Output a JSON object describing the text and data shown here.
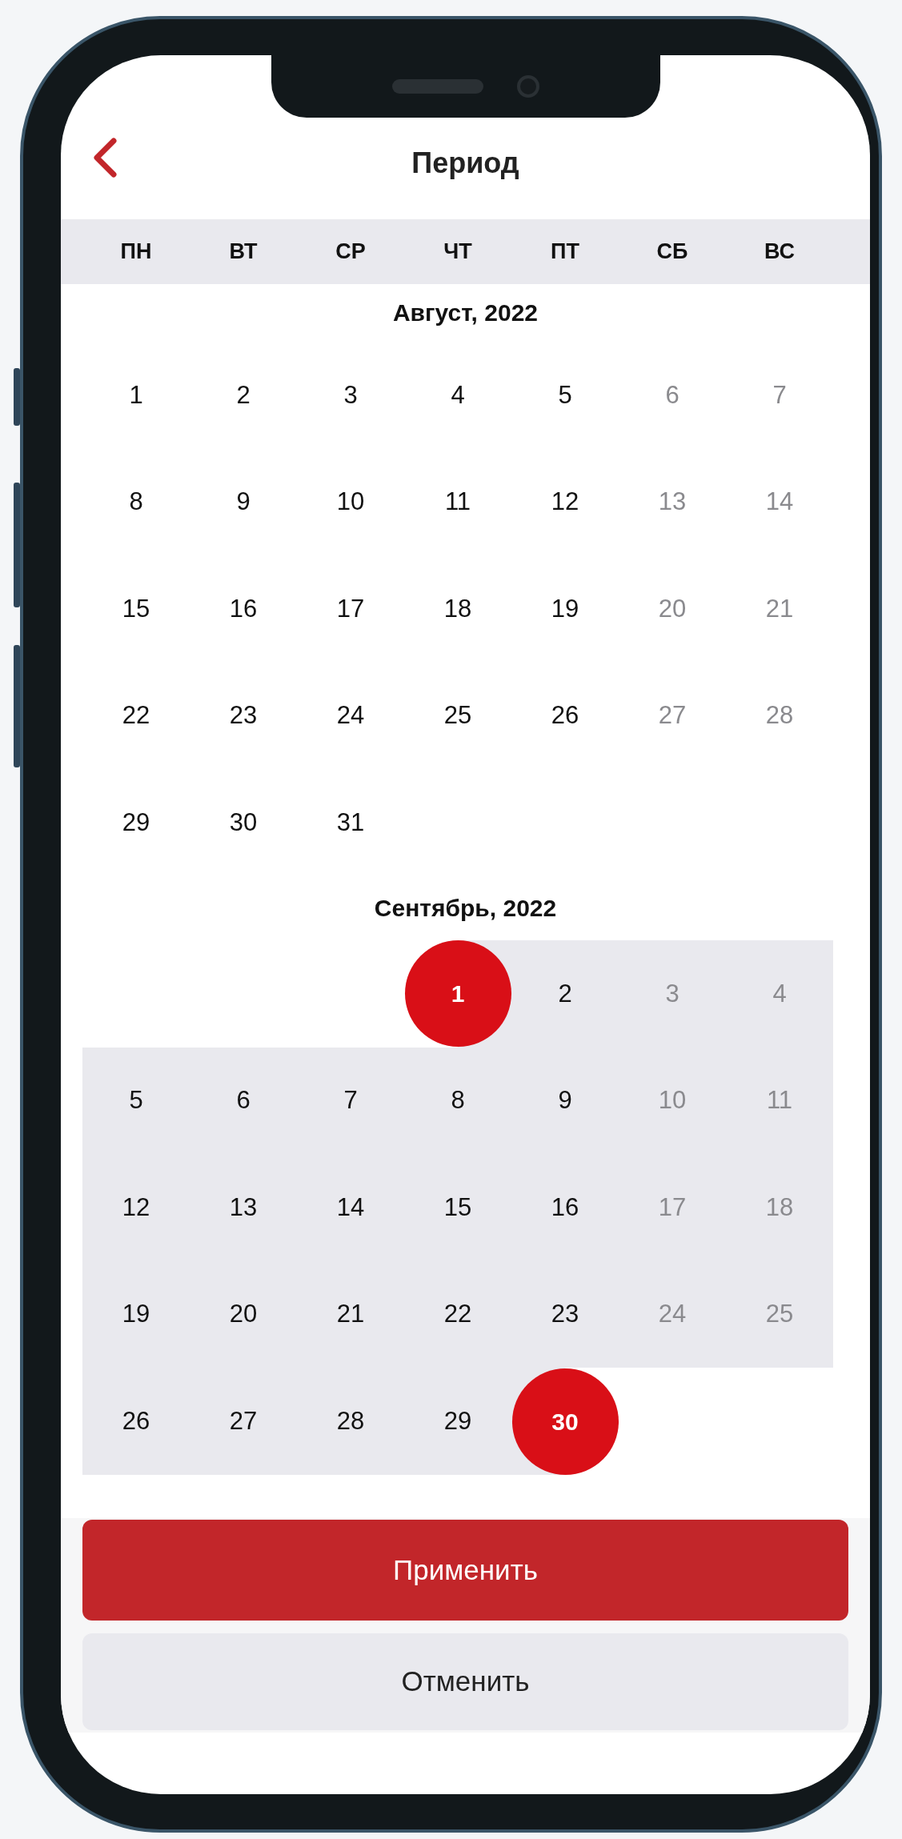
{
  "header": {
    "title": "Период"
  },
  "weekdays": [
    "ПН",
    "ВТ",
    "СР",
    "ЧТ",
    "ПТ",
    "СБ",
    "ВС"
  ],
  "months": [
    {
      "title": "Август, 2022",
      "weeks": [
        [
          {
            "kind": "day",
            "day": "1",
            "weekend": false,
            "in_range": false,
            "selected": false
          },
          {
            "kind": "day",
            "day": "2",
            "weekend": false,
            "in_range": false,
            "selected": false
          },
          {
            "kind": "day",
            "day": "3",
            "weekend": false,
            "in_range": false,
            "selected": false
          },
          {
            "kind": "day",
            "day": "4",
            "weekend": false,
            "in_range": false,
            "selected": false
          },
          {
            "kind": "day",
            "day": "5",
            "weekend": false,
            "in_range": false,
            "selected": false
          },
          {
            "kind": "day",
            "day": "6",
            "weekend": true,
            "in_range": false,
            "selected": false
          },
          {
            "kind": "day",
            "day": "7",
            "weekend": true,
            "in_range": false,
            "selected": false
          }
        ],
        [
          {
            "kind": "day",
            "day": "8",
            "weekend": false,
            "in_range": false,
            "selected": false
          },
          {
            "kind": "day",
            "day": "9",
            "weekend": false,
            "in_range": false,
            "selected": false
          },
          {
            "kind": "day",
            "day": "10",
            "weekend": false,
            "in_range": false,
            "selected": false
          },
          {
            "kind": "day",
            "day": "11",
            "weekend": false,
            "in_range": false,
            "selected": false
          },
          {
            "kind": "day",
            "day": "12",
            "weekend": false,
            "in_range": false,
            "selected": false
          },
          {
            "kind": "day",
            "day": "13",
            "weekend": true,
            "in_range": false,
            "selected": false
          },
          {
            "kind": "day",
            "day": "14",
            "weekend": true,
            "in_range": false,
            "selected": false
          }
        ],
        [
          {
            "kind": "day",
            "day": "15",
            "weekend": false,
            "in_range": false,
            "selected": false
          },
          {
            "kind": "day",
            "day": "16",
            "weekend": false,
            "in_range": false,
            "selected": false
          },
          {
            "kind": "day",
            "day": "17",
            "weekend": false,
            "in_range": false,
            "selected": false
          },
          {
            "kind": "day",
            "day": "18",
            "weekend": false,
            "in_range": false,
            "selected": false
          },
          {
            "kind": "day",
            "day": "19",
            "weekend": false,
            "in_range": false,
            "selected": false
          },
          {
            "kind": "day",
            "day": "20",
            "weekend": true,
            "in_range": false,
            "selected": false
          },
          {
            "kind": "day",
            "day": "21",
            "weekend": true,
            "in_range": false,
            "selected": false
          }
        ],
        [
          {
            "kind": "day",
            "day": "22",
            "weekend": false,
            "in_range": false,
            "selected": false
          },
          {
            "kind": "day",
            "day": "23",
            "weekend": false,
            "in_range": false,
            "selected": false
          },
          {
            "kind": "day",
            "day": "24",
            "weekend": false,
            "in_range": false,
            "selected": false
          },
          {
            "kind": "day",
            "day": "25",
            "weekend": false,
            "in_range": false,
            "selected": false
          },
          {
            "kind": "day",
            "day": "26",
            "weekend": false,
            "in_range": false,
            "selected": false
          },
          {
            "kind": "day",
            "day": "27",
            "weekend": true,
            "in_range": false,
            "selected": false
          },
          {
            "kind": "day",
            "day": "28",
            "weekend": true,
            "in_range": false,
            "selected": false
          }
        ],
        [
          {
            "kind": "day",
            "day": "29",
            "weekend": false,
            "in_range": false,
            "selected": false
          },
          {
            "kind": "day",
            "day": "30",
            "weekend": false,
            "in_range": false,
            "selected": false
          },
          {
            "kind": "day",
            "day": "31",
            "weekend": false,
            "in_range": false,
            "selected": false
          }
        ]
      ]
    },
    {
      "title": "Сентябрь, 2022",
      "weeks": [
        [
          {
            "kind": "blank"
          },
          {
            "kind": "blank"
          },
          {
            "kind": "blank"
          },
          {
            "kind": "day",
            "day": "1",
            "weekend": false,
            "in_range": true,
            "selected": true
          },
          {
            "kind": "day",
            "day": "2",
            "weekend": false,
            "in_range": true,
            "selected": false
          },
          {
            "kind": "day",
            "day": "3",
            "weekend": true,
            "in_range": true,
            "selected": false
          },
          {
            "kind": "day",
            "day": "4",
            "weekend": true,
            "in_range": true,
            "selected": false
          }
        ],
        [
          {
            "kind": "day",
            "day": "5",
            "weekend": false,
            "in_range": true,
            "selected": false
          },
          {
            "kind": "day",
            "day": "6",
            "weekend": false,
            "in_range": true,
            "selected": false
          },
          {
            "kind": "day",
            "day": "7",
            "weekend": false,
            "in_range": true,
            "selected": false
          },
          {
            "kind": "day",
            "day": "8",
            "weekend": false,
            "in_range": true,
            "selected": false
          },
          {
            "kind": "day",
            "day": "9",
            "weekend": false,
            "in_range": true,
            "selected": false
          },
          {
            "kind": "day",
            "day": "10",
            "weekend": true,
            "in_range": true,
            "selected": false
          },
          {
            "kind": "day",
            "day": "11",
            "weekend": true,
            "in_range": true,
            "selected": false
          }
        ],
        [
          {
            "kind": "day",
            "day": "12",
            "weekend": false,
            "in_range": true,
            "selected": false
          },
          {
            "kind": "day",
            "day": "13",
            "weekend": false,
            "in_range": true,
            "selected": false
          },
          {
            "kind": "day",
            "day": "14",
            "weekend": false,
            "in_range": true,
            "selected": false
          },
          {
            "kind": "day",
            "day": "15",
            "weekend": false,
            "in_range": true,
            "selected": false
          },
          {
            "kind": "day",
            "day": "16",
            "weekend": false,
            "in_range": true,
            "selected": false
          },
          {
            "kind": "day",
            "day": "17",
            "weekend": true,
            "in_range": true,
            "selected": false
          },
          {
            "kind": "day",
            "day": "18",
            "weekend": true,
            "in_range": true,
            "selected": false
          }
        ],
        [
          {
            "kind": "day",
            "day": "19",
            "weekend": false,
            "in_range": true,
            "selected": false
          },
          {
            "kind": "day",
            "day": "20",
            "weekend": false,
            "in_range": true,
            "selected": false
          },
          {
            "kind": "day",
            "day": "21",
            "weekend": false,
            "in_range": true,
            "selected": false
          },
          {
            "kind": "day",
            "day": "22",
            "weekend": false,
            "in_range": true,
            "selected": false
          },
          {
            "kind": "day",
            "day": "23",
            "weekend": false,
            "in_range": true,
            "selected": false
          },
          {
            "kind": "day",
            "day": "24",
            "weekend": true,
            "in_range": true,
            "selected": false
          },
          {
            "kind": "day",
            "day": "25",
            "weekend": true,
            "in_range": true,
            "selected": false
          }
        ],
        [
          {
            "kind": "day",
            "day": "26",
            "weekend": false,
            "in_range": true,
            "selected": false
          },
          {
            "kind": "day",
            "day": "27",
            "weekend": false,
            "in_range": true,
            "selected": false
          },
          {
            "kind": "day",
            "day": "28",
            "weekend": false,
            "in_range": true,
            "selected": false
          },
          {
            "kind": "day",
            "day": "29",
            "weekend": false,
            "in_range": true,
            "selected": false
          },
          {
            "kind": "day",
            "day": "30",
            "weekend": false,
            "in_range": true,
            "selected": true
          }
        ]
      ]
    }
  ],
  "buttons": [
    {
      "kind": "primary",
      "label": "Применить"
    },
    {
      "kind": "secondary",
      "label": "Отменить"
    }
  ]
}
